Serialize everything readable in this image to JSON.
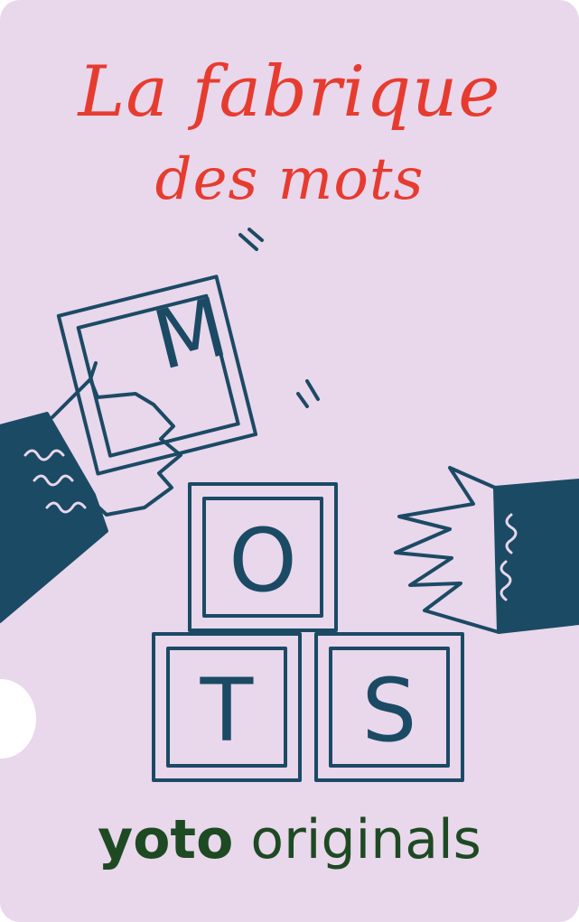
{
  "card": {
    "title_line1": "La fabrique",
    "title_line2": "des mots",
    "blocks": {
      "top": "M",
      "middle": "O",
      "bottom_left": "T",
      "bottom_right": "S"
    },
    "brand": {
      "bold": "yoto",
      "regular": "originals"
    }
  },
  "colors": {
    "background": "#e9d7ec",
    "title": "#e63c2f",
    "ink": "#1b4a64",
    "brand": "#1d4a22"
  }
}
